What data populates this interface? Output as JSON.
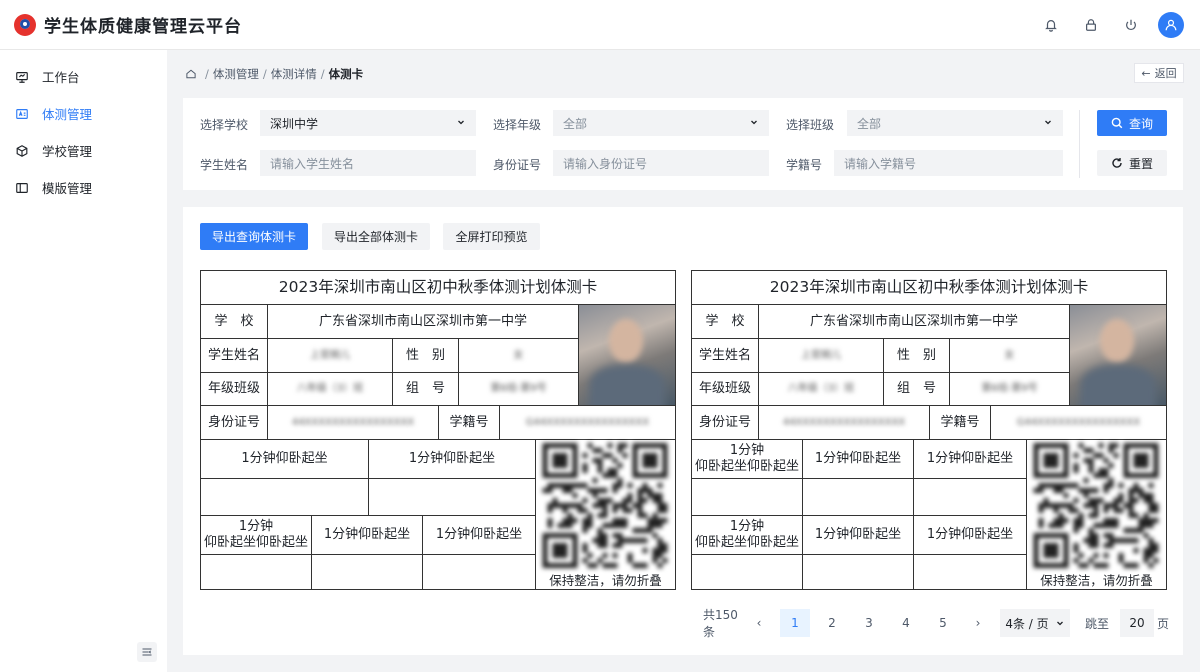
{
  "header": {
    "app_title": "学生体质健康管理云平台",
    "icons": [
      "bell-icon",
      "lock-icon",
      "power-icon",
      "user-icon"
    ]
  },
  "sidebar": {
    "items": [
      {
        "label": "工作台",
        "icon": "monitor-icon"
      },
      {
        "label": "体测管理",
        "icon": "id-card-icon",
        "active": true
      },
      {
        "label": "学校管理",
        "icon": "cube-icon"
      },
      {
        "label": "模版管理",
        "icon": "layout-icon"
      }
    ]
  },
  "breadcrumb": [
    "体测管理",
    "体测详情",
    "体测卡"
  ],
  "back_label": "返回",
  "filters": {
    "school_label": "选择学校",
    "school_value": "深圳中学",
    "grade_label": "选择年级",
    "grade_value": "全部",
    "class_label": "选择班级",
    "class_value": "全部",
    "name_label": "学生姓名",
    "name_placeholder": "请输入学生姓名",
    "id_label": "身份证号",
    "id_placeholder": "请输入身份证号",
    "sid_label": "学籍号",
    "sid_placeholder": "请输入学籍号",
    "query_label": "查询",
    "reset_label": "重置"
  },
  "toolbar": {
    "export_query": "导出查询体测卡",
    "export_all": "导出全部体测卡",
    "print_preview": "全屏打印预览"
  },
  "card": {
    "title": "2023年深圳市南山区初中秋季体测计划体测卡",
    "school_label": "学　校",
    "school_value": "广东省深圳市南山区深圳市第一中学",
    "name_label": "学生姓名",
    "name_value": "上官婉儿",
    "gender_label": "性　别",
    "gender_value": "女",
    "grade_label": "年级班级",
    "grade_value": "八年级（3）班",
    "group_label": "组　号",
    "group_value": "第6组-第9号",
    "id_label": "身份证号",
    "id_value": "44XXXXXXXXXXXXXXXX",
    "sid_label": "学籍号",
    "sid_value": "G44XXXXXXXXXXXXXXX",
    "test_item": "1分钟仰卧起坐",
    "test_item_line1": "1分钟",
    "test_item_line2": "仰卧起坐仰卧起坐",
    "qr_caption": "保持整洁，请勿折叠"
  },
  "pagination": {
    "total": "共150条",
    "pages": [
      "1",
      "2",
      "3",
      "4",
      "5"
    ],
    "current": "1",
    "page_size": "4条 / 页",
    "jump_label": "跳至",
    "jump_value": "20",
    "page_unit": "页"
  },
  "colors": {
    "accent": "#2f7cf6",
    "brand_red": "#e5322d"
  }
}
